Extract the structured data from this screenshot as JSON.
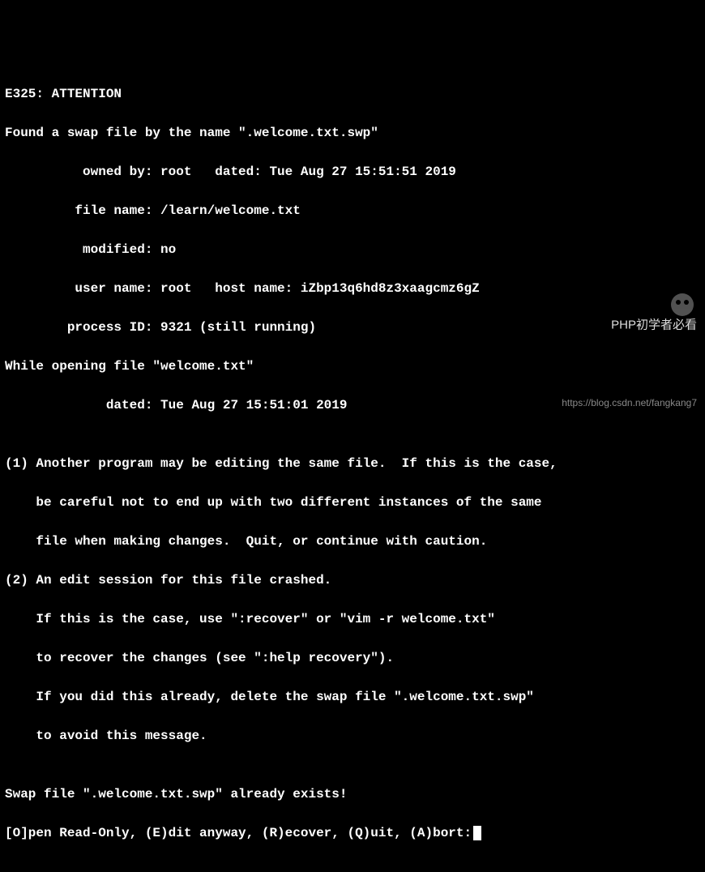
{
  "vim_swap": {
    "header": "E325: ATTENTION",
    "found_line": "Found a swap file by the name \".welcome.txt.swp\"",
    "owned_by": "          owned by: root   dated: Tue Aug 27 15:51:51 2019",
    "file_name": "         file name: /learn/welcome.txt",
    "modified": "          modified: no",
    "user_name": "         user name: root   host name: iZbp13q6hd8z3xaagcmz6gZ",
    "process_id": "        process ID: 9321 (still running)",
    "while_opening": "While opening file \"welcome.txt\"",
    "dated2": "             dated: Tue Aug 27 15:51:01 2019",
    "blank1": "",
    "advice1a": "(1) Another program may be editing the same file.  If this is the case,",
    "advice1b": "    be careful not to end up with two different instances of the same",
    "advice1c": "    file when making changes.  Quit, or continue with caution.",
    "advice2a": "(2) An edit session for this file crashed.",
    "advice2b": "    If this is the case, use \":recover\" or \"vim -r welcome.txt\"",
    "advice2c": "    to recover the changes (see \":help recovery\").",
    "advice2d": "    If you did this already, delete the swap file \".welcome.txt.swp\"",
    "advice2e": "    to avoid this message.",
    "blank2": "",
    "exists": "Swap file \".welcome.txt.swp\" already exists!",
    "prompt": "[O]pen Read-Only, (E)dit anyway, (R)ecover, (Q)uit, (A)bort:"
  },
  "watermark": {
    "title": "PHP初学者必看",
    "url": "https://blog.csdn.net/fangkang7"
  }
}
